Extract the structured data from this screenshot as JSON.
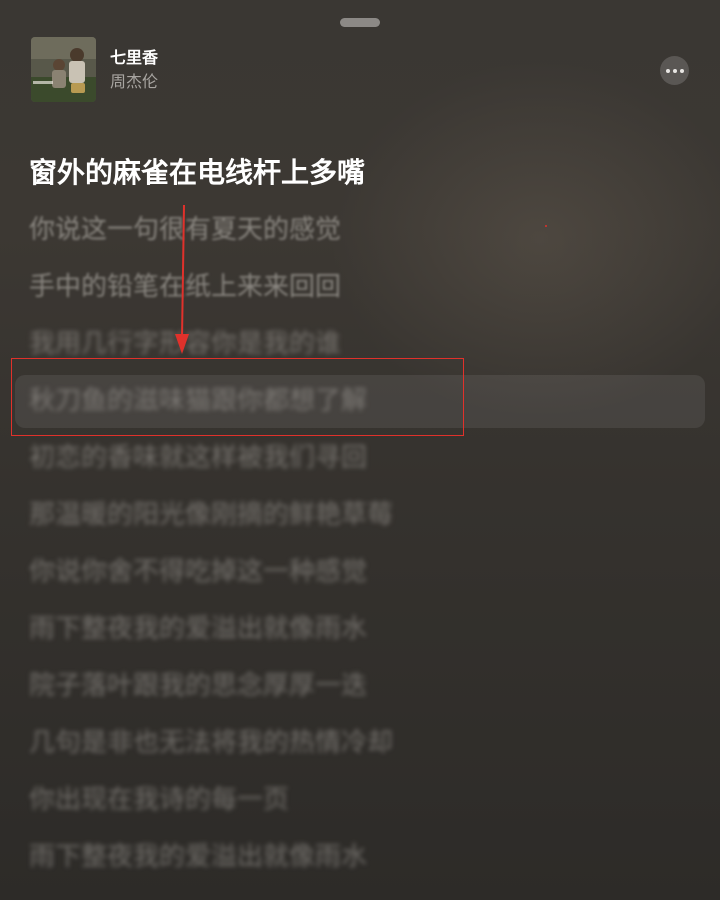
{
  "now_playing": {
    "title": "七里香",
    "artist": "周杰伦"
  },
  "lyrics": {
    "current": "窗外的麻雀在电线杆上多嘴",
    "upcoming": [
      "你说这一句很有夏天的感觉",
      "手中的铅笔在纸上来来回回",
      "我用几行字形容你是我的谁",
      "秋刀鱼的滋味猫跟你都想了解",
      "初恋的香味就这样被我们寻回",
      "那温暖的阳光像刚摘的鲜艳草莓",
      "你说你舍不得吃掉这一种感觉",
      "雨下整夜我的爱溢出就像雨水",
      "院子落叶跟我的思念厚厚一迭",
      "几句是非也无法将我的热情冷却",
      "你出现在我诗的每一页",
      "雨下整夜我的爱溢出就像雨水"
    ]
  },
  "colors": {
    "background": "#3a3733",
    "annotation": "#e0312b"
  },
  "icons": {
    "more": "ellipsis-icon"
  }
}
